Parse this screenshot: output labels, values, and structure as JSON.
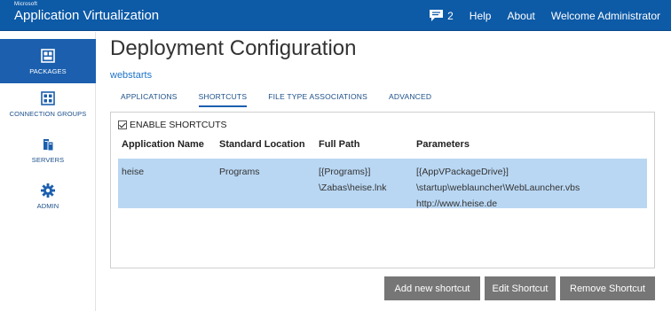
{
  "header": {
    "brand_small": "Microsoft",
    "brand_title": "Application Virtualization",
    "message_count": "2",
    "nav": {
      "help": "Help",
      "about": "About",
      "welcome": "Welcome Administrator"
    }
  },
  "sidebar": {
    "items": [
      {
        "label": "PACKAGES",
        "icon": "packages-icon",
        "active": true
      },
      {
        "label": "CONNECTION GROUPS",
        "icon": "connection-groups-icon",
        "active": false
      },
      {
        "label": "SERVERS",
        "icon": "servers-icon",
        "active": false
      },
      {
        "label": "ADMIN",
        "icon": "gear-icon",
        "active": false
      }
    ]
  },
  "page": {
    "title": "Deployment Configuration",
    "breadcrumb": "webstarts"
  },
  "tabs": [
    {
      "label": "APPLICATIONS",
      "active": false
    },
    {
      "label": "SHORTCUTS",
      "active": true
    },
    {
      "label": "FILE TYPE ASSOCIATIONS",
      "active": false
    },
    {
      "label": "ADVANCED",
      "active": false
    }
  ],
  "shortcuts": {
    "enable_label": "ENABLE SHORTCUTS",
    "enabled": true,
    "columns": [
      "Application Name",
      "Standard Location",
      "Full Path",
      "Parameters"
    ],
    "rows": [
      {
        "application_name": "heise",
        "standard_location": "Programs",
        "full_path": [
          "[{Programs}]",
          "\\Zabas\\heise.lnk"
        ],
        "parameters": [
          "[{AppVPackageDrive}]",
          "\\startup\\weblauncher\\WebLauncher.vbs",
          "http://www.heise.de"
        ]
      }
    ]
  },
  "buttons": {
    "add": "Add new shortcut",
    "edit": "Edit Shortcut",
    "remove": "Remove Shortcut"
  },
  "colors": {
    "header_bg": "#0d5aa7",
    "sidebar_active": "#1b5fae",
    "selected_row": "#b9d7f3",
    "button_bg": "#767676",
    "link": "#1c73c8"
  }
}
